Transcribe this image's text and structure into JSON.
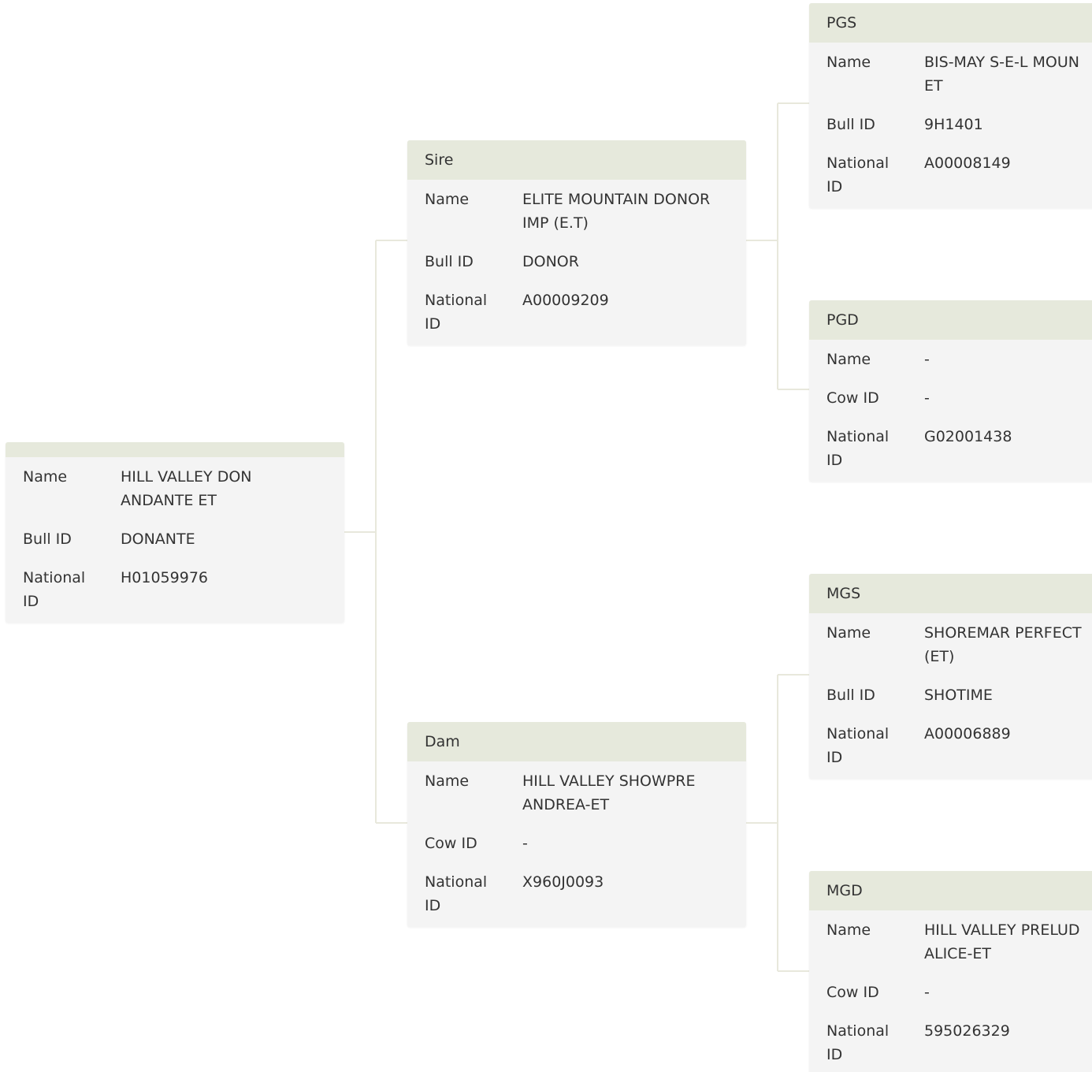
{
  "pedigree": {
    "animal": {
      "title": "",
      "rows": [
        {
          "label": "Name",
          "value": "HILL VALLEY DON ANDANTE ET"
        },
        {
          "label": "Bull ID",
          "value": "DONANTE"
        },
        {
          "label": "National ID",
          "value": "H01059976"
        }
      ]
    },
    "sire": {
      "title": "Sire",
      "rows": [
        {
          "label": "Name",
          "value": "ELITE MOUNTAIN DONOR IMP (E.T)"
        },
        {
          "label": "Bull ID",
          "value": "DONOR"
        },
        {
          "label": "National ID",
          "value": "A00009209"
        }
      ]
    },
    "dam": {
      "title": "Dam",
      "rows": [
        {
          "label": "Name",
          "value": "HILL VALLEY SHOWPRE ANDREA-ET"
        },
        {
          "label": "Cow ID",
          "value": "-"
        },
        {
          "label": "National ID",
          "value": "X960J0093"
        }
      ]
    },
    "pgs": {
      "title": "PGS",
      "rows": [
        {
          "label": "Name",
          "value": "BIS-MAY S-E-L MOUN",
          "value2": "ET"
        },
        {
          "label": "Bull ID",
          "value": "9H1401"
        },
        {
          "label": "National ID",
          "value": "A00008149"
        }
      ]
    },
    "pgd": {
      "title": "PGD",
      "rows": [
        {
          "label": "Name",
          "value": "-"
        },
        {
          "label": "Cow ID",
          "value": "-"
        },
        {
          "label": "National ID",
          "value": "G02001438"
        }
      ]
    },
    "mgs": {
      "title": "MGS",
      "rows": [
        {
          "label": "Name",
          "value": "SHOREMAR PERFECT",
          "value2": "(ET)"
        },
        {
          "label": "Bull ID",
          "value": "SHOTIME"
        },
        {
          "label": "National ID",
          "value": "A00006889"
        }
      ]
    },
    "mgd": {
      "title": "MGD",
      "rows": [
        {
          "label": "Name",
          "value": "HILL VALLEY PRELUD",
          "value2": "ALICE-ET"
        },
        {
          "label": "Cow ID",
          "value": "-"
        },
        {
          "label": "National ID",
          "value": "595026329"
        }
      ]
    }
  }
}
